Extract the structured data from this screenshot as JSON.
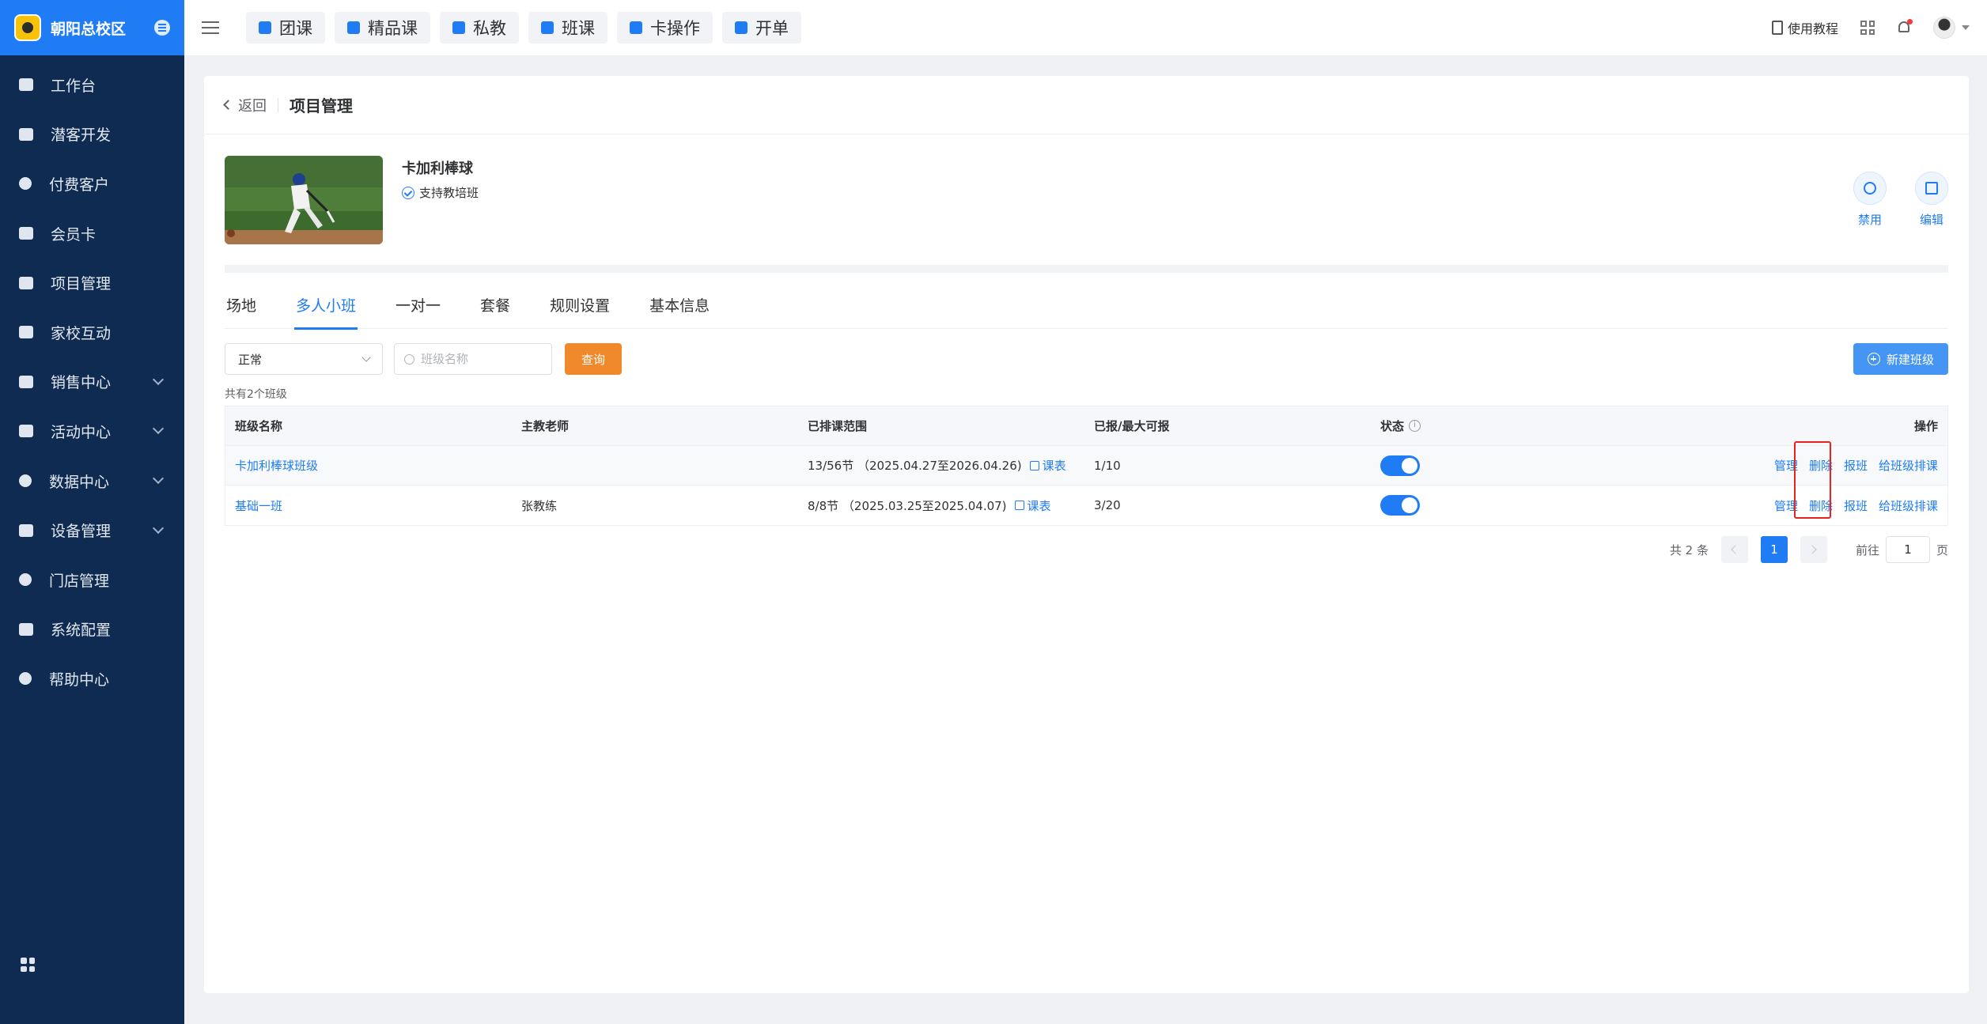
{
  "brand": {
    "name": "朝阳总校区"
  },
  "sidebar": {
    "items": [
      {
        "label": "工作台"
      },
      {
        "label": "潜客开发"
      },
      {
        "label": "付费客户"
      },
      {
        "label": "会员卡"
      },
      {
        "label": "项目管理"
      },
      {
        "label": "家校互动"
      },
      {
        "label": "销售中心"
      },
      {
        "label": "活动中心"
      },
      {
        "label": "数据中心"
      },
      {
        "label": "设备管理"
      },
      {
        "label": "门店管理"
      },
      {
        "label": "系统配置"
      },
      {
        "label": "帮助中心"
      }
    ]
  },
  "topbar": {
    "quick": [
      {
        "label": "团课"
      },
      {
        "label": "精品课"
      },
      {
        "label": "私教"
      },
      {
        "label": "班课"
      },
      {
        "label": "卡操作"
      },
      {
        "label": "开单"
      }
    ],
    "tutorial": "使用教程"
  },
  "header": {
    "back": "返回",
    "title": "项目管理"
  },
  "project": {
    "name": "卡加利棒球",
    "tag": "支持教培班",
    "actions": {
      "disable": "禁用",
      "edit": "编辑"
    }
  },
  "tabs": [
    {
      "label": "场地"
    },
    {
      "label": "多人小班"
    },
    {
      "label": "一对一"
    },
    {
      "label": "套餐"
    },
    {
      "label": "规则设置"
    },
    {
      "label": "基本信息"
    }
  ],
  "filters": {
    "status_value": "正常",
    "search_placeholder": "班级名称",
    "query": "查询",
    "new_class": "新建班级"
  },
  "count_text": "共有2个班级",
  "table": {
    "headers": {
      "name": "班级名称",
      "teacher": "主教老师",
      "range": "已排课范围",
      "enrolled": "已报/最大可报",
      "status": "状态",
      "ops": "操作"
    },
    "schedule_link": "课表",
    "ops": {
      "manage": "管理",
      "delete": "删除",
      "enroll": "报班",
      "arrange": "给班级排课"
    },
    "rows": [
      {
        "name": "卡加利棒球班级",
        "teacher": "",
        "range": "13/56节 （2025.04.27至2026.04.26)",
        "enrolled": "1/10",
        "status_on": true
      },
      {
        "name": "基础一班",
        "teacher": "张教练",
        "range": "8/8节 （2025.03.25至2025.04.07)",
        "enrolled": "3/20",
        "status_on": true
      }
    ]
  },
  "pagination": {
    "total": "共 2 条",
    "current": "1",
    "goto_label": "前往",
    "goto_value": "1",
    "page_unit": "页"
  }
}
